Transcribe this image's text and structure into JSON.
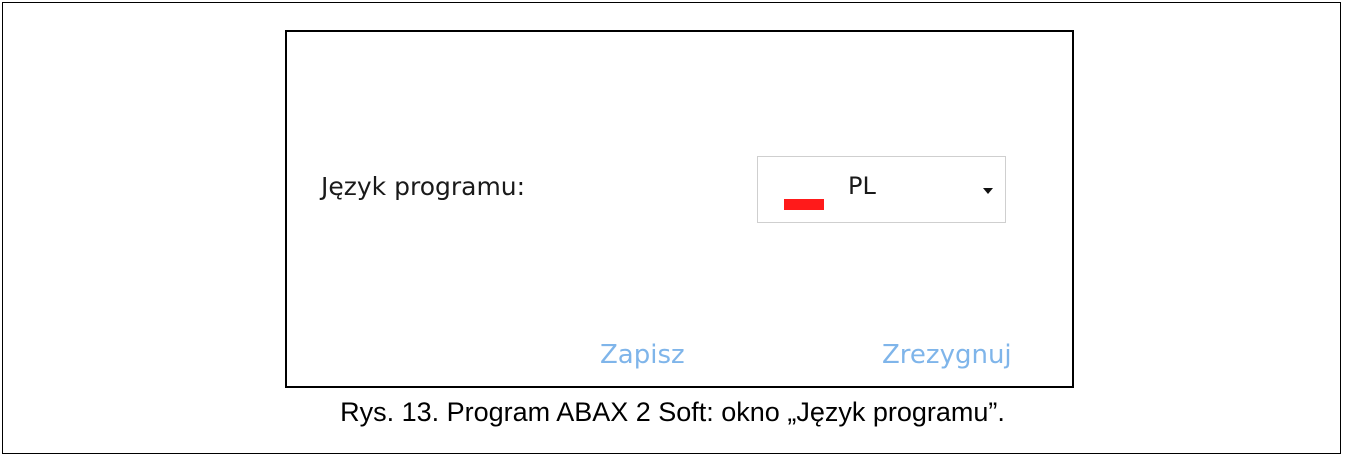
{
  "dialog": {
    "language_label": "Język programu:",
    "language_select": {
      "value": "PL",
      "flag_color": "#ff1a1a",
      "flag_icon": "poland-flag-icon"
    },
    "save_label": "Zapisz",
    "cancel_label": "Zrezygnuj",
    "button_color": "#7fb5ea"
  },
  "caption": "Rys. 13. Program ABAX 2 Soft: okno „Język programu”."
}
